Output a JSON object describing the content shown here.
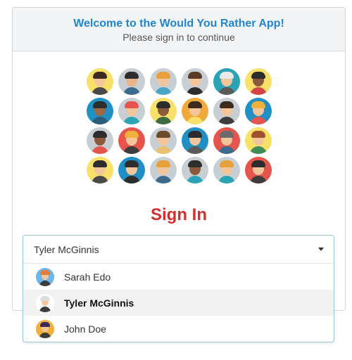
{
  "header": {
    "title": "Welcome to the Would You Rather App!",
    "subtitle": "Please sign in to continue"
  },
  "avatars": {
    "icon": "user-avatar-icon",
    "count": 24,
    "colors": [
      {
        "bg": "#f7e168",
        "skin": "#f5c69a",
        "hair": "#3d2b1f",
        "shirt": "#4a4a4a"
      },
      {
        "bg": "#c8cfd4",
        "skin": "#e8b48a",
        "hair": "#2d2d2d",
        "shirt": "#3b6b8c"
      },
      {
        "bg": "#c8cfd4",
        "skin": "#f2c59b",
        "hair": "#e6a03c",
        "shirt": "#49a6c6"
      },
      {
        "bg": "#c8cfd4",
        "skin": "#f2c59b",
        "hair": "#5a3b25",
        "shirt": "#2d2d2d"
      },
      {
        "bg": "#2aa3b5",
        "skin": "#f2c59b",
        "hair": "#e9e9e9",
        "shirt": "#5a5a5a"
      },
      {
        "bg": "#f7e168",
        "skin": "#8a5a3b",
        "hair": "#2d2d2d",
        "shirt": "#d64545"
      },
      {
        "bg": "#1f8fc4",
        "skin": "#9a6a45",
        "hair": "#2d2d2d",
        "shirt": "#2d5b7a"
      },
      {
        "bg": "#c8cfd4",
        "skin": "#f2c59b",
        "hair": "#e5554d",
        "shirt": "#2aa3b5"
      },
      {
        "bg": "#f7e168",
        "skin": "#8a5a3b",
        "hair": "#2d2d2d",
        "shirt": "#3d6b45"
      },
      {
        "bg": "#f0a93b",
        "skin": "#f2c59b",
        "hair": "#3d2b1f",
        "shirt": "#f7e168"
      },
      {
        "bg": "#c8cfd4",
        "skin": "#f2c59b",
        "hair": "#3d2b1f",
        "shirt": "#3d3d3d"
      },
      {
        "bg": "#1f8fc4",
        "skin": "#f2c59b",
        "hair": "#f0b03b",
        "shirt": "#e5554d"
      },
      {
        "bg": "#c8cfd4",
        "skin": "#8a5a3b",
        "hair": "#2d2d2d",
        "shirt": "#e5554d"
      },
      {
        "bg": "#e5554d",
        "skin": "#f2c59b",
        "hair": "#f0b03b",
        "shirt": "#3d3d3d"
      },
      {
        "bg": "#c8cfd4",
        "skin": "#f2c59b",
        "hair": "#6b4b2d",
        "shirt": "#e8c070"
      },
      {
        "bg": "#1f8fc4",
        "skin": "#f2c59b",
        "hair": "#2d2d2d",
        "shirt": "#5a5a5a"
      },
      {
        "bg": "#e5554d",
        "skin": "#f2c59b",
        "hair": "#6b6b6b",
        "shirt": "#3d6b8c"
      },
      {
        "bg": "#f7e168",
        "skin": "#f2c59b",
        "hair": "#a0522d",
        "shirt": "#3d8c5a"
      },
      {
        "bg": "#f7e168",
        "skin": "#f2c59b",
        "hair": "#2d2d2d",
        "shirt": "#4a4a4a"
      },
      {
        "bg": "#1f8fc4",
        "skin": "#f2c59b",
        "hair": "#2d2d2d",
        "shirt": "#2d2d2d"
      },
      {
        "bg": "#c8cfd4",
        "skin": "#f2c59b",
        "hair": "#e6a03c",
        "shirt": "#3d6b8c"
      },
      {
        "bg": "#c8cfd4",
        "skin": "#8a5a3b",
        "hair": "#2d2d2d",
        "shirt": "#2aa3b5"
      },
      {
        "bg": "#c8cfd4",
        "skin": "#f2c59b",
        "hair": "#e6a03c",
        "shirt": "#2aa3b5"
      },
      {
        "bg": "#e5554d",
        "skin": "#f2c59b",
        "hair": "#2d2d2d",
        "shirt": "#3d3d3d"
      }
    ]
  },
  "signin": {
    "title": "Sign In"
  },
  "dropdown": {
    "selected": "Tyler McGinnis",
    "options": [
      {
        "label": "Sarah Edo",
        "icon": "sarah-edo-avatar-icon",
        "active": false,
        "bg": "#6bb7e8",
        "skin": "#f2c59b",
        "hair": "#e87a3a"
      },
      {
        "label": "Tyler McGinnis",
        "icon": "tyler-mcginnis-avatar-icon",
        "active": true,
        "bg": "#ffffff",
        "skin": "#f2c59b",
        "hair": "#dddddd"
      },
      {
        "label": "John Doe",
        "icon": "john-doe-avatar-icon",
        "active": false,
        "bg": "#f0b03b",
        "skin": "#f2c59b",
        "hair": "#3d2b5a"
      }
    ]
  },
  "colors": {
    "accent": "#2185d0",
    "signin_red": "#d32f2f",
    "header_bg": "#f3f4f5",
    "dropdown_border": "#96c8da"
  }
}
